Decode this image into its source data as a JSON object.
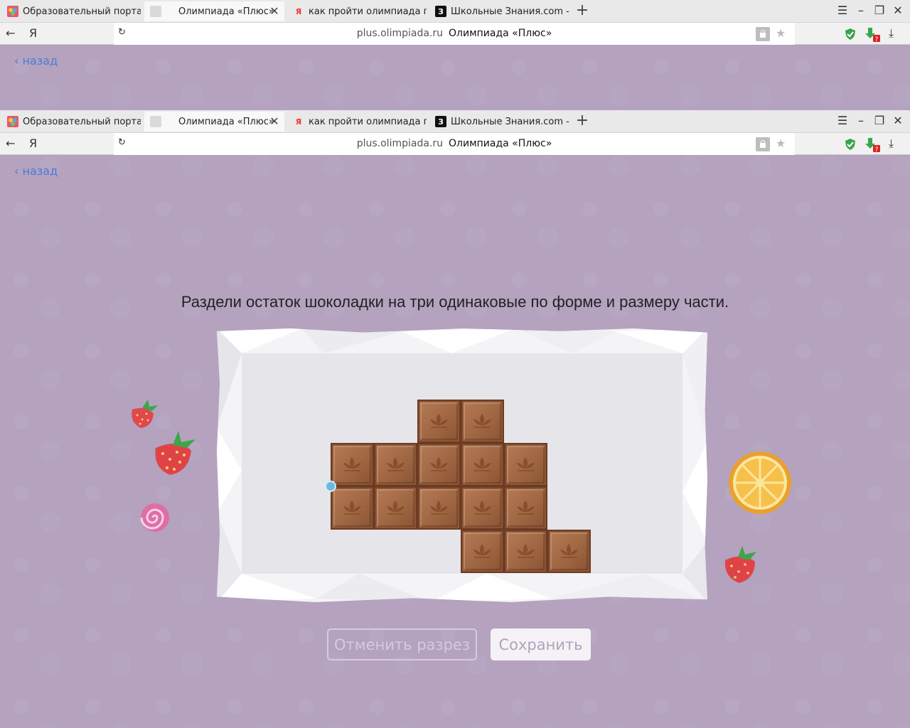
{
  "browser": {
    "tabs": [
      {
        "title": "Образовательный портал н",
        "favicon": "olympiad-logo-icon",
        "active": false
      },
      {
        "title": "Олимпиада «Плюс»",
        "favicon": "blank-page-icon",
        "active": true
      },
      {
        "title": "как пройти олимпиада плк",
        "favicon": "yandex-icon",
        "active": false
      },
      {
        "title": "Школьные Знания.com - Ре",
        "favicon": "znanija-icon",
        "active": false
      }
    ],
    "yandex_logo": "Я",
    "address_domain": "plus.olimpiada.ru",
    "address_title": "Олимпиада «Плюс»",
    "favicon_yandex": "Я",
    "favicon_znanija": "З"
  },
  "page": {
    "back_label": "назад",
    "instruction": "Раздели остаток шоколадки на три одинаковые по форме и размеру части.",
    "cancel_label": "Отменить разрез",
    "save_label": "Сохранить"
  },
  "colors": {
    "background": "#b4a2bf",
    "chocolate": "#8e5636",
    "back_link": "#4b7ad6",
    "cut_dot": "#69b9e2"
  }
}
